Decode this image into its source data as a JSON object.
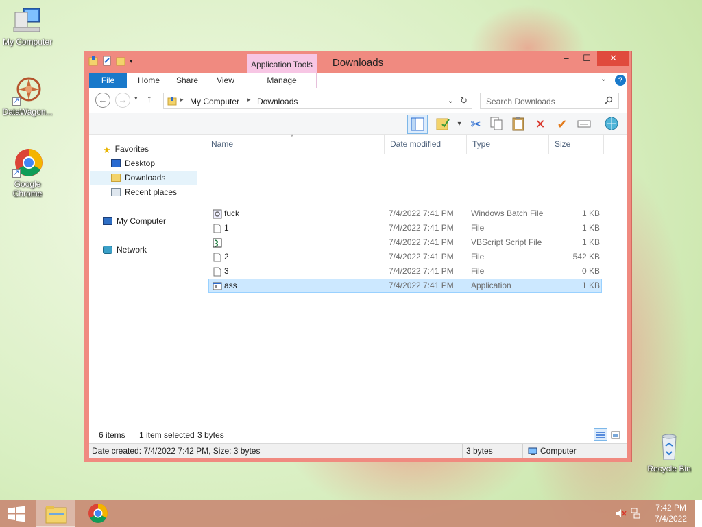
{
  "desktop": {
    "icons": [
      {
        "label": "My Computer"
      },
      {
        "label": "DataWagon..."
      },
      {
        "label": "Google\nChrome",
        "line1": "Google",
        "line2": "Chrome"
      },
      {
        "label": "Recycle Bin"
      }
    ]
  },
  "window": {
    "title": "Downloads",
    "context_tab": "Application Tools",
    "controls": {
      "minimize": "‒",
      "maximize": "☐",
      "close": "✕"
    },
    "tabs": [
      "File",
      "Home",
      "Share",
      "View",
      "Manage"
    ],
    "help": "?",
    "address": {
      "crumbs": [
        "My Computer",
        "Downloads"
      ]
    },
    "search": {
      "placeholder": "Search Downloads"
    },
    "nav": {
      "favorites": "Favorites",
      "desktop": "Desktop",
      "downloads": "Downloads",
      "recent": "Recent places",
      "computer": "My Computer",
      "network": "Network"
    },
    "columns": [
      "Name",
      "Date modified",
      "Type",
      "Size"
    ],
    "files": [
      {
        "name": "fuck",
        "date": "7/4/2022 7:41 PM",
        "type": "Windows Batch File",
        "size": "1 KB",
        "icon": "batch-file-icon"
      },
      {
        "name": "1",
        "date": "7/4/2022 7:41 PM",
        "type": "File",
        "size": "1 KB",
        "icon": "file-icon"
      },
      {
        "name": "",
        "date": "7/4/2022 7:41 PM",
        "type": "VBScript Script File",
        "size": "1 KB",
        "icon": "vbscript-icon"
      },
      {
        "name": "2",
        "date": "7/4/2022 7:41 PM",
        "type": "File",
        "size": "542 KB",
        "icon": "file-icon"
      },
      {
        "name": "3",
        "date": "7/4/2022 7:41 PM",
        "type": "File",
        "size": "0 KB",
        "icon": "file-icon"
      },
      {
        "name": "ass",
        "date": "7/4/2022 7:41 PM",
        "type": "Application",
        "size": "1 KB",
        "icon": "application-icon",
        "selected": true
      }
    ],
    "status": {
      "items": "6 items",
      "selected": "1 item selected",
      "bytes": "3 bytes",
      "details": "Date created: 7/4/2022 7:42 PM, Size: 3 bytes",
      "size2": "3 bytes",
      "location": "Computer"
    }
  },
  "taskbar": {
    "time": "7:42 PM",
    "date": "7/4/2022"
  },
  "colors": {
    "frame": "#f08a80",
    "accent": "#1979ca",
    "selection": "#cce8ff",
    "context_tab": "#f7c6e4"
  }
}
